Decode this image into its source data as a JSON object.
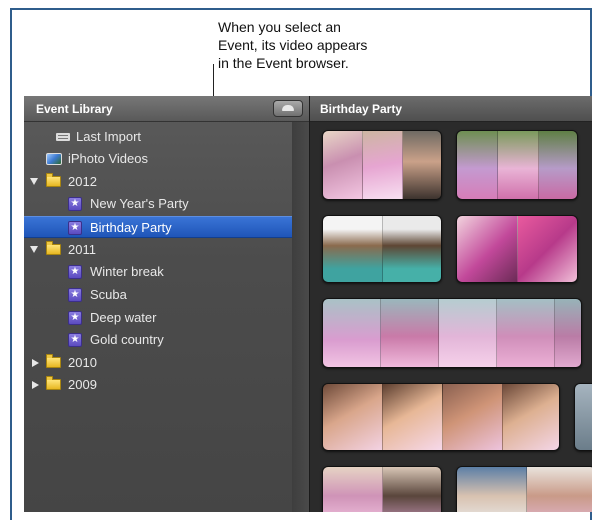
{
  "callout": {
    "lines": [
      "When you select an",
      "Event, its video appears",
      "in the Event browser."
    ]
  },
  "library": {
    "title": "Event Library",
    "items": [
      {
        "label": "Last Import",
        "icon": "last-import-icon"
      },
      {
        "label": "iPhoto Videos",
        "icon": "iphoto-icon"
      },
      {
        "label": "2012",
        "icon": "folder-icon",
        "expanded": true
      },
      {
        "label": "New Year's Party",
        "icon": "event-star-icon"
      },
      {
        "label": "Birthday Party",
        "icon": "event-star-icon",
        "selected": true
      },
      {
        "label": "2011",
        "icon": "folder-icon",
        "expanded": true
      },
      {
        "label": "Winter break",
        "icon": "event-star-icon"
      },
      {
        "label": "Scuba",
        "icon": "event-star-icon"
      },
      {
        "label": "Deep water",
        "icon": "event-star-icon"
      },
      {
        "label": "Gold country",
        "icon": "event-star-icon"
      },
      {
        "label": "2010",
        "icon": "folder-icon",
        "expanded": false
      },
      {
        "label": "2009",
        "icon": "folder-icon",
        "expanded": false
      }
    ]
  },
  "browser": {
    "title": "Birthday Party"
  },
  "colors": {
    "selection": "#2a62c9",
    "library_bg": "#4f4f4f",
    "browser_bg": "#2b2b2b",
    "frame_border": "#2f5d8c"
  }
}
